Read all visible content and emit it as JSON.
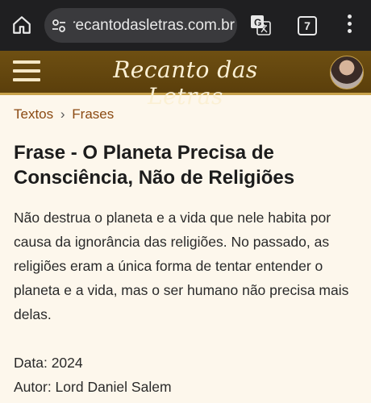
{
  "browser": {
    "url": "recantodasletras.com.br",
    "tab_count": "7"
  },
  "site": {
    "name": "Recanto das Letras"
  },
  "breadcrumb": {
    "items": [
      {
        "label": "Textos"
      },
      {
        "label": "Frases"
      }
    ],
    "separator": "›"
  },
  "article": {
    "title": "Frase - O Planeta Precisa de Consciência, Não de Religiões",
    "body": "Não destrua o planeta e a vida que nele habita por causa da ignorância das religiões. No passado, as religiões eram a única forma de tentar entender o planeta e a vida, mas o ser humano não precisa mais delas.",
    "date_line": "Data: 2024",
    "author_line": "Autor: Lord Daniel Salem"
  },
  "colors": {
    "header_brown": "#6e4f12",
    "accent_gold": "#c8a24a",
    "link_brown": "#8b4a12",
    "page_background": "#fdf7ec"
  }
}
